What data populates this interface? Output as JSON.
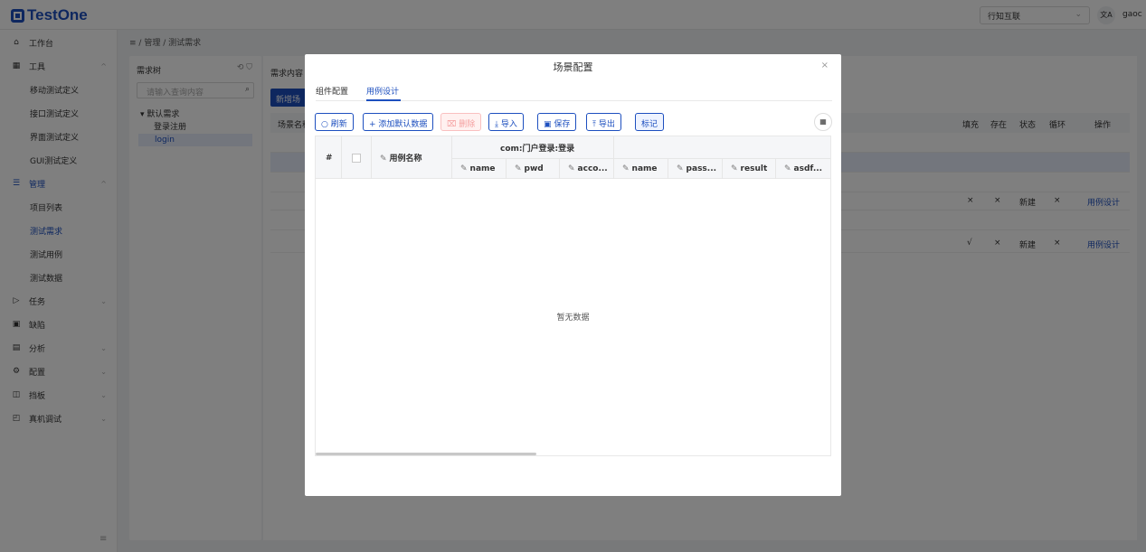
{
  "topbar": {
    "logo": "TestOne",
    "org": "行知互联",
    "lang_icon": "文A",
    "user": "gaoc"
  },
  "sidebar": {
    "items": [
      {
        "label": "工作台",
        "icon": "home-icon"
      },
      {
        "label": "工具",
        "icon": "grid-icon"
      },
      {
        "label": "移动测试定义"
      },
      {
        "label": "接口测试定义"
      },
      {
        "label": "界面测试定义"
      },
      {
        "label": "GUI测试定义"
      },
      {
        "label": "管理",
        "icon": "list-icon"
      },
      {
        "label": "项目列表"
      },
      {
        "label": "测试需求"
      },
      {
        "label": "测试用例"
      },
      {
        "label": "测试数据"
      },
      {
        "label": "任务",
        "icon": "send-icon"
      },
      {
        "label": "缺陷",
        "icon": "bug-icon"
      },
      {
        "label": "分析",
        "icon": "chart-icon"
      },
      {
        "label": "配置",
        "icon": "gear-icon"
      },
      {
        "label": "挡板",
        "icon": "panel-icon"
      },
      {
        "label": "真机调试",
        "icon": "device-icon"
      }
    ]
  },
  "breadcrumb": {
    "menu_icon": "≡",
    "sep": "/",
    "level1": "管理",
    "level2": "测试需求"
  },
  "tree": {
    "title": "需求树",
    "search_placeholder": "请输入查询内容",
    "root": "默认需求",
    "child1": "登录注册",
    "child2": "login"
  },
  "content": {
    "label": "需求内容",
    "new_button": "新增场",
    "header_name": "场景名称",
    "headers": [
      "填充",
      "存在",
      "状态",
      "循环",
      "操作"
    ],
    "rows": [
      {
        "fill": "×",
        "exist": "×",
        "status": "新建",
        "loop": "×",
        "action": "用例设计"
      },
      {
        "fill": "√",
        "exist": "×",
        "status": "新建",
        "loop": "×",
        "action": "用例设计"
      }
    ]
  },
  "modal": {
    "title": "场景配置",
    "close": "×",
    "tabs": [
      "组件配置",
      "用例设计"
    ],
    "toolbar": {
      "refresh": "刷新",
      "add_default": "添加默认数据",
      "delete": "删除",
      "import": "导入",
      "save": "保存",
      "export": "导出",
      "mark": "标记"
    },
    "table": {
      "col_index": "#",
      "col_case_name": "用例名称",
      "group_header": "com:门户登录:登录",
      "sub_cols": [
        "name",
        "pwd",
        "acco...",
        "name",
        "pass...",
        "result",
        "asdf..."
      ],
      "empty_text": "暂无数据"
    }
  }
}
